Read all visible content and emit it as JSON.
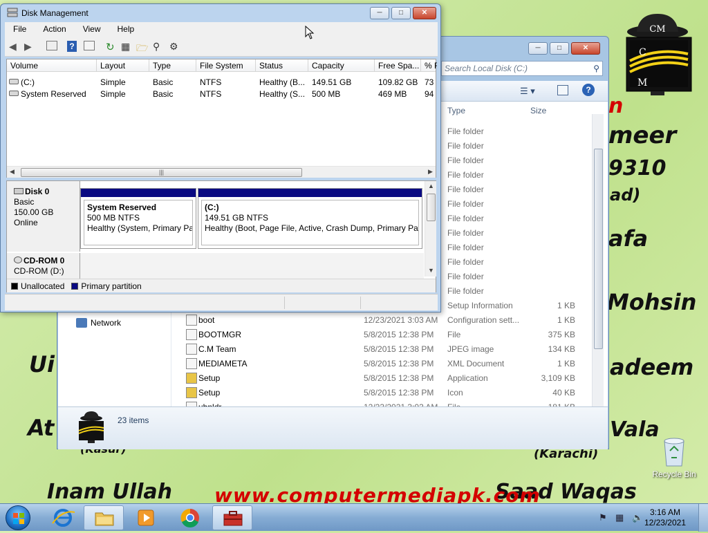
{
  "wallpaper": {
    "lines": [
      "n",
      "meer",
      "9310",
      "ad)",
      "afa",
      "Mohsin",
      "adeem",
      "Vala",
      "(Karachi)",
      "Inam Ullah",
      "Saad Waqas",
      "Ui",
      "At",
      "(Kasur)"
    ],
    "url": "www.computermediapk.com",
    "logo_letters": [
      "CM",
      "C",
      "M"
    ]
  },
  "desktop": {
    "recycle_bin_label": "Recycle Bin"
  },
  "explorer": {
    "search_placeholder": "Search Local Disk (C:)",
    "columns": {
      "type": "Type",
      "size": "Size"
    },
    "folder_type": "File folder",
    "folder_row_count": 12,
    "nav_network": "Network",
    "files": [
      {
        "name": "",
        "date": "",
        "type": "Setup Information",
        "size": "1 KB"
      },
      {
        "name": "boot",
        "date": "12/23/2021 3:03 AM",
        "type": "Configuration sett...",
        "size": "1 KB"
      },
      {
        "name": "BOOTMGR",
        "date": "5/8/2015 12:38 PM",
        "type": "File",
        "size": "375 KB"
      },
      {
        "name": "C.M Team",
        "date": "5/8/2015 12:38 PM",
        "type": "JPEG image",
        "size": "134 KB"
      },
      {
        "name": "MEDIAMETA",
        "date": "5/8/2015 12:38 PM",
        "type": "XML Document",
        "size": "1 KB"
      },
      {
        "name": "Setup",
        "date": "5/8/2015 12:38 PM",
        "type": "Application",
        "size": "3,109 KB"
      },
      {
        "name": "Setup",
        "date": "5/8/2015 12:38 PM",
        "type": "Icon",
        "size": "40 KB"
      },
      {
        "name": "ubnldr",
        "date": "12/23/2021 3:03 AM",
        "type": "File",
        "size": "181 KB"
      }
    ],
    "status": {
      "items": "23 items"
    }
  },
  "disk_mgmt": {
    "title": "Disk Management",
    "menu": [
      "File",
      "Action",
      "View",
      "Help"
    ],
    "columns": [
      "Volume",
      "Layout",
      "Type",
      "File System",
      "Status",
      "Capacity",
      "Free Spa...",
      "% F"
    ],
    "volumes": [
      {
        "volume": "(C:)",
        "layout": "Simple",
        "type": "Basic",
        "fs": "NTFS",
        "status": "Healthy (B...",
        "capacity": "149.51 GB",
        "free": "109.82 GB",
        "pct": "73"
      },
      {
        "volume": "System Reserved",
        "layout": "Simple",
        "type": "Basic",
        "fs": "NTFS",
        "status": "Healthy (S...",
        "capacity": "500 MB",
        "free": "469 MB",
        "pct": "94"
      }
    ],
    "disk0": {
      "name": "Disk 0",
      "kind": "Basic",
      "size": "150.00 GB",
      "state": "Online",
      "partitions": [
        {
          "name": "System Reserved",
          "size": "500 MB NTFS",
          "status": "Healthy (System, Primary Par"
        },
        {
          "name": "(C:)",
          "size": "149.51 GB NTFS",
          "status": "Healthy (Boot, Page File, Active, Crash Dump, Primary Parti"
        }
      ]
    },
    "cdrom": {
      "name": "CD-ROM 0",
      "drive": "CD-ROM (D:)"
    },
    "legend": {
      "unallocated": "Unallocated",
      "primary": "Primary partition",
      "unallocated_color": "#000000",
      "primary_color": "#0a0a82"
    }
  },
  "taskbar": {
    "time": "3:16 AM",
    "date": "12/23/2021"
  }
}
